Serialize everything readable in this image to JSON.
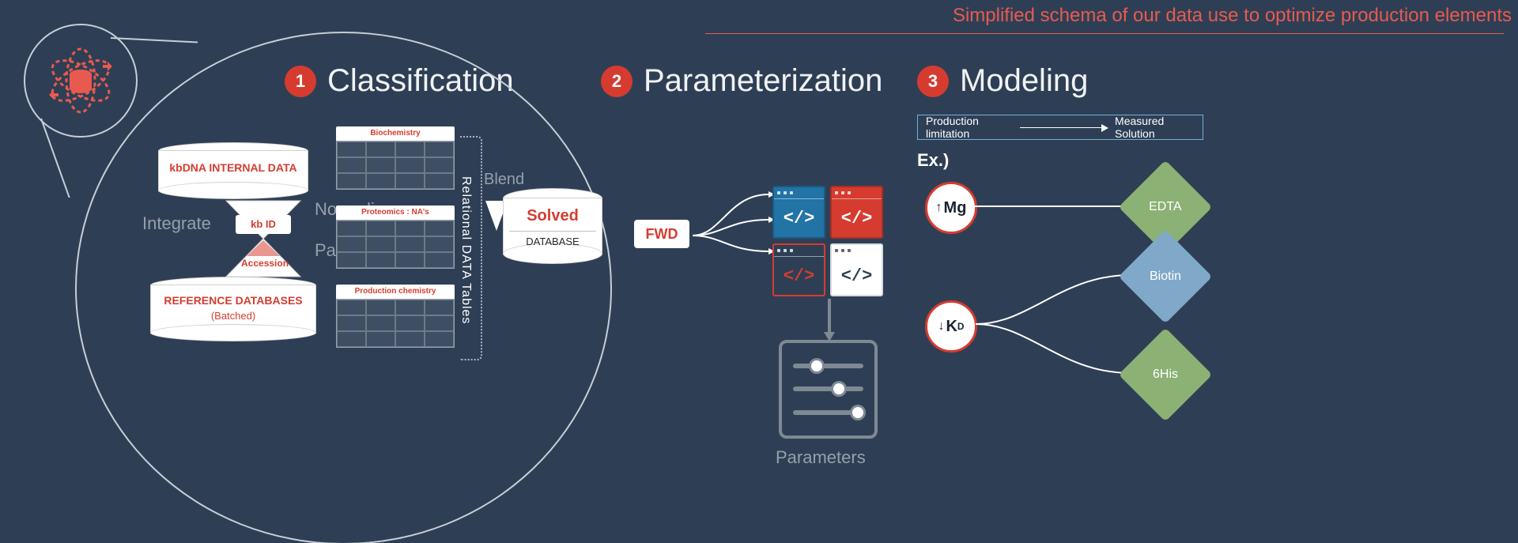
{
  "caption": "Simplified schema of our data use to optimize production elements",
  "steps": {
    "s1": {
      "num": "1",
      "title": "Classification"
    },
    "s2": {
      "num": "2",
      "title": "Parameterization"
    },
    "s3": {
      "num": "3",
      "title": "Modeling"
    }
  },
  "classification": {
    "cyl_top": "kbDNA INTERNAL DATA",
    "cyl_bottom_line1": "REFERENCE DATABASES",
    "cyl_bottom_line2": "(Batched)",
    "kb_id": "kb ID",
    "accession": "Accession",
    "integrate": "Integrate",
    "normalize": "Normalize",
    "plus": "+",
    "partition": "Partition",
    "tables": {
      "t1": "Biochemistry",
      "t2": "Proteomics : NA's",
      "t3": "Production chemistry"
    },
    "bracket_lbl": "Relational DATA Tables",
    "blend": "Blend",
    "solved": "Solved",
    "database": "DATABASE"
  },
  "parameterization": {
    "fwd": "FWD",
    "code_glyph": "</>",
    "parameters": "Parameters"
  },
  "modeling": {
    "legend_left": "Production  limitation",
    "legend_right": "Measured Solution",
    "ex": "Ex.)",
    "mg_arrow": "↑",
    "mg": "Mg",
    "kd_arrow": "↓",
    "kd": "K",
    "kd_sub": "D",
    "edta": "EDTA",
    "biotin": "Biotin",
    "his": "6His"
  }
}
